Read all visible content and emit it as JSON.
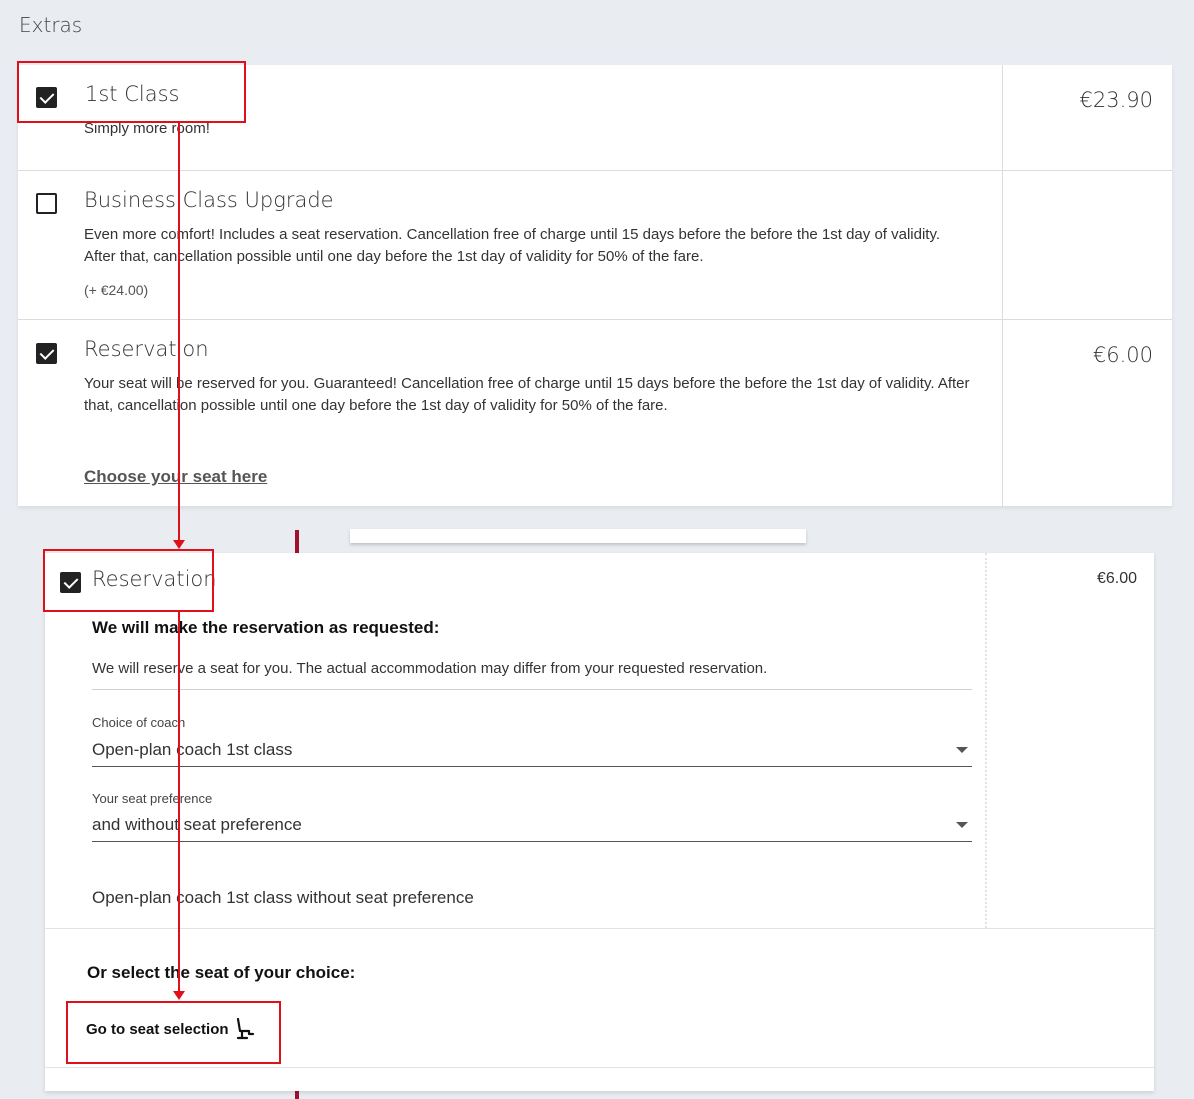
{
  "section": {
    "title": "Extras"
  },
  "options": [
    {
      "title": "1st Class",
      "description": "Simply more room!",
      "price": "€23.90",
      "checked": true
    },
    {
      "title": "Business Class Upgrade",
      "description": "Even more comfort! Includes a seat reservation. Cancellation free of charge until 15 days before the before the 1st day of validity. After that, cancellation possible until one day before the 1st day of validity for 50% of the fare.",
      "extra": "(+ €24.00)",
      "checked": false
    },
    {
      "title": "Reservation",
      "description": "Your seat will be reserved for you. Guaranteed! Cancellation free of charge until 15 days before the before the 1st day of validity. After that, cancellation possible until one day before the 1st day of validity for 50% of the fare.",
      "price": "€6.00",
      "link": "Choose your seat here",
      "checked": true
    }
  ],
  "reservation_detail": {
    "title": "Reservation",
    "price": "€6.00",
    "heading": "We will make the reservation as requested:",
    "info": "We will reserve a seat for you. The actual accommodation may differ from your requested reservation.",
    "coach_label": "Choice of coach",
    "coach_value": "Open-plan coach 1st class",
    "pref_label": "Your seat preference",
    "pref_value": "and without seat preference",
    "summary": "Open-plan coach 1st class without seat preference",
    "alt_heading": "Or select the seat of your choice:",
    "seat_button": "Go to seat selection"
  },
  "colors": {
    "accent_red": "#e0101a",
    "brand_bar": "#a0112b"
  },
  "icons": {
    "seat": "seat-icon",
    "checkbox": "check-icon",
    "dropdown": "chevron-down-icon"
  }
}
